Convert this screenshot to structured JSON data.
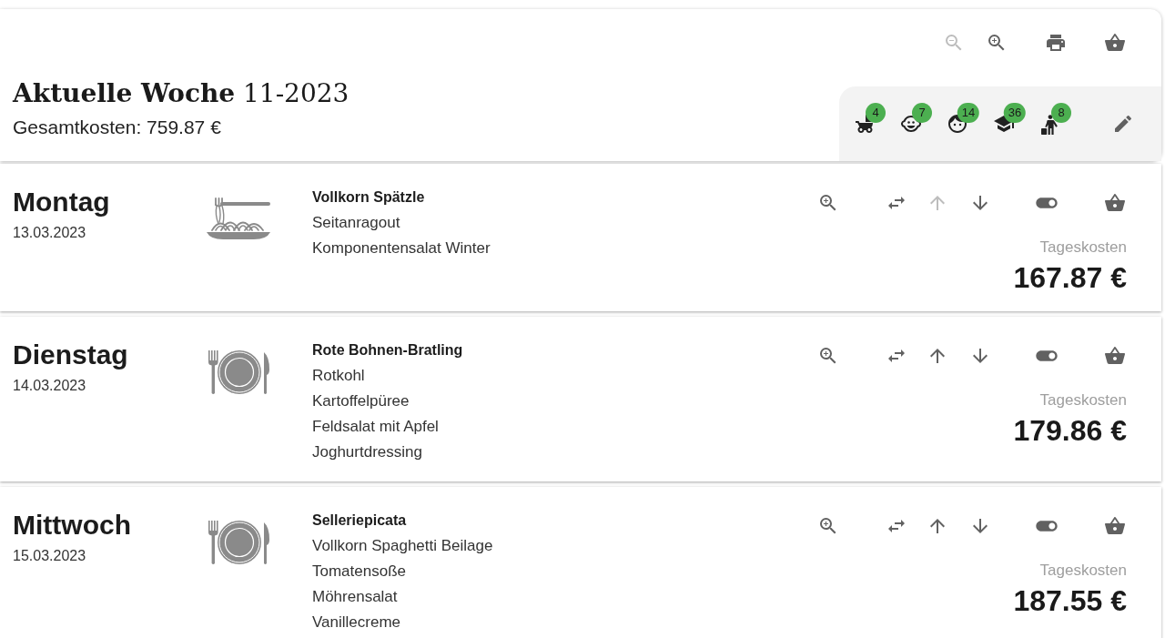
{
  "toolbar": [
    {
      "kind": "zoom-out",
      "disabled": true
    },
    {
      "kind": "zoom-in",
      "disabled": false
    },
    {
      "kind": "print",
      "disabled": false
    },
    {
      "kind": "basket",
      "disabled": false
    }
  ],
  "week": {
    "title": "**Aktuelle Woche** 11-2023",
    "total": "Gesamtkosten: 759.87 €"
  },
  "groups": [
    {
      "kind": "stroller",
      "count": "4"
    },
    {
      "kind": "baby",
      "count": "7"
    },
    {
      "kind": "child",
      "count": "14"
    },
    {
      "kind": "student",
      "count": "36"
    },
    {
      "kind": "senior",
      "count": "8"
    }
  ],
  "days": [
    {
      "kind": "noodles",
      "name": "Montag",
      "date": "13.03.2023",
      "dishes": [
        "Vollkorn Spätzle",
        "Seitanragout",
        "Komponentensalat Winter"
      ],
      "move_up_disabled": true,
      "move_down_disabled": false,
      "on": true,
      "cost_label": "Tageskosten",
      "cost": "167.87 €"
    },
    {
      "kind": "plate",
      "name": "Dienstag",
      "date": "14.03.2023",
      "dishes": [
        "Rote Bohnen-Bratling",
        "Rotkohl",
        "Kartoffelpüree",
        "Feldsalat mit Apfel",
        "Joghurtdressing"
      ],
      "move_up_disabled": false,
      "move_down_disabled": false,
      "on": true,
      "cost_label": "Tageskosten",
      "cost": "179.86 €"
    },
    {
      "kind": "plate",
      "name": "Mittwoch",
      "date": "15.03.2023",
      "dishes": [
        "Selleriepicata",
        "Vollkorn Spaghetti Beilage",
        "Tomatensoße",
        "Möhrensalat",
        "Vanillecreme"
      ],
      "move_up_disabled": false,
      "move_down_disabled": false,
      "on": true,
      "cost_label": "Tageskosten",
      "cost": "187.55 €"
    }
  ]
}
